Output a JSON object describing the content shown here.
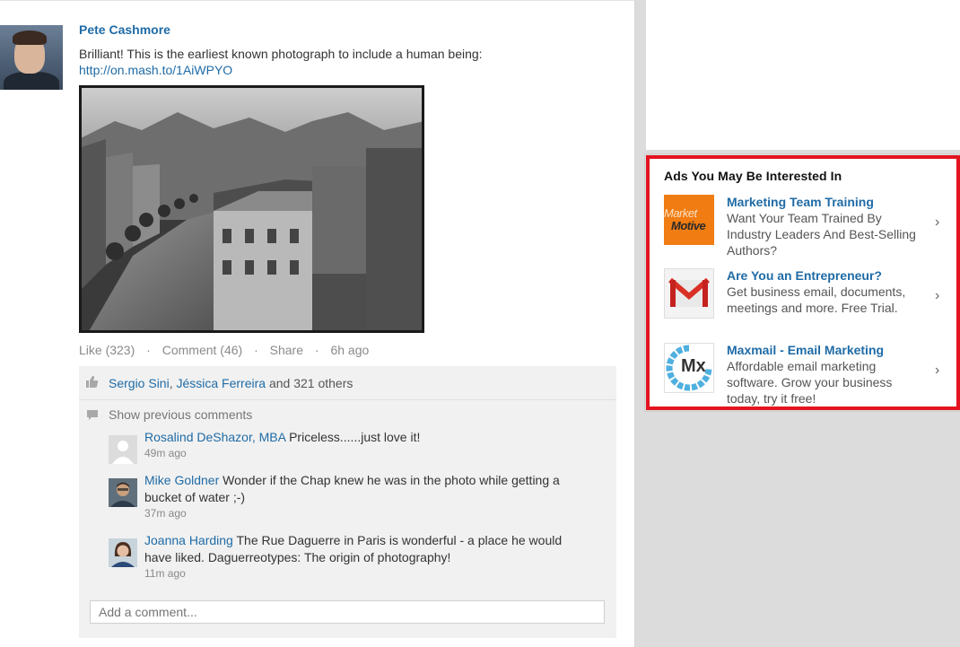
{
  "post": {
    "author": "Pete Cashmore",
    "text": "Brilliant! This is the earliest known photograph to include a human being:",
    "link": "http://on.mash.to/1AiWPYO",
    "actions": {
      "like": "Like (323)",
      "comment": "Comment (46)",
      "share": "Share",
      "time": "6h ago",
      "separator": "·"
    }
  },
  "likes": {
    "names": [
      "Sergio Sini",
      "Jéssica Ferreira"
    ],
    "name_separator": ", ",
    "rest": " and 321 others"
  },
  "show_previous": "Show previous comments",
  "comments": [
    {
      "name": "Rosalind DeShazor, MBA",
      "text": "Priceless......just love it!",
      "time": "49m ago"
    },
    {
      "name": "Mike Goldner",
      "text": "Wonder if the Chap knew he was in the photo while getting a bucket of water ;-)",
      "time": "37m ago"
    },
    {
      "name": "Joanna Harding",
      "text": "The Rue Daguerre in Paris is wonderful - a place he would have liked. Daguerreotypes: The origin of photography!",
      "time": "11m ago"
    }
  ],
  "add_comment_placeholder": "Add a comment...",
  "ads": {
    "title": "Ads You May Be Interested In",
    "items": [
      {
        "title": "Marketing Team Training",
        "desc": "Want Your Team Trained By Industry Leaders And Best-Selling Authors?",
        "logo_text_top": "Market",
        "logo_text_bottom": "Motive",
        "icon": "market-motive-logo"
      },
      {
        "title": "Are You an Entrepreneur?",
        "desc": "Get business email, documents, meetings and more. Free Trial.",
        "icon": "gmail-logo"
      },
      {
        "title": "Maxmail - Email Marketing",
        "desc": "Affordable email marketing software. Grow your business today, try it free!",
        "logo_text": "Mx",
        "icon": "maxmail-logo"
      }
    ],
    "chevron": "›"
  },
  "colors": {
    "link": "#1f6ba6",
    "highlight_border": "#e3141f",
    "page_background": "#dcdcdc"
  }
}
